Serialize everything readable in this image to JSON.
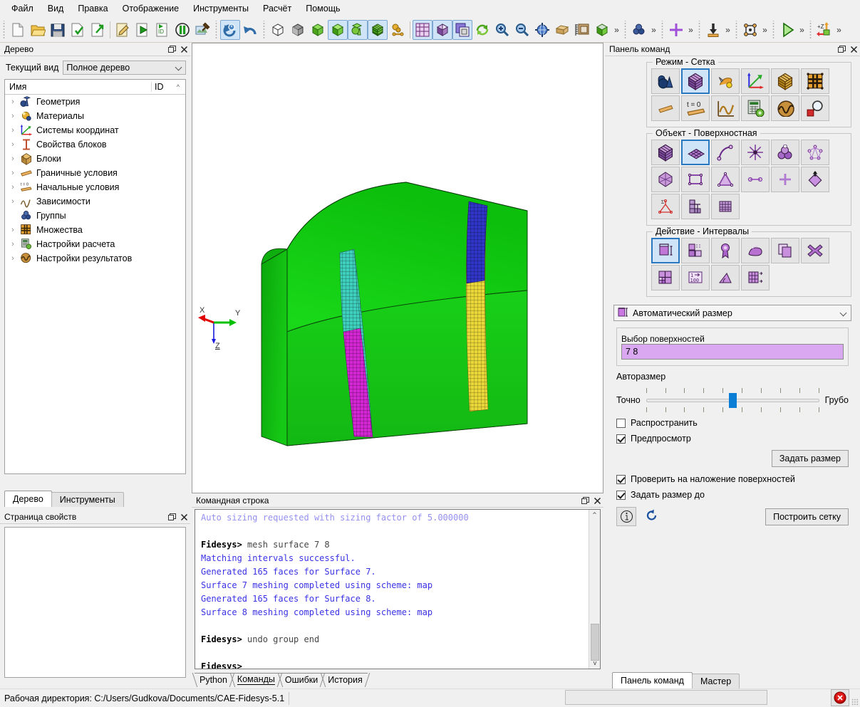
{
  "menu": {
    "items": [
      "Файл",
      "Вид",
      "Правка",
      "Отображение",
      "Инструменты",
      "Расчёт",
      "Помощь"
    ]
  },
  "toolbar": {
    "groups": [
      {
        "name": "file-group",
        "buttons": [
          {
            "icon": "new-document-icon",
            "active": false
          },
          {
            "icon": "open-folder-icon",
            "active": false
          },
          {
            "icon": "save-floppy-icon",
            "active": false
          },
          {
            "icon": "import-journal-icon",
            "active": false
          },
          {
            "icon": "export-journal-icon",
            "active": false
          },
          {
            "sep": true
          },
          {
            "icon": "edit-journal-icon",
            "active": false
          },
          {
            "icon": "play-journal-icon",
            "active": false
          },
          {
            "icon": "id-document-icon",
            "active": false
          },
          {
            "icon": "pause-icon",
            "active": false
          },
          {
            "icon": "build-hammer-icon",
            "active": false
          }
        ]
      },
      {
        "name": "undo-group",
        "buttons": [
          {
            "icon": "reset-undo-icon",
            "active": true
          },
          {
            "icon": "undo-arrow-icon",
            "active": false
          }
        ]
      },
      {
        "name": "display-group",
        "buttons": [
          {
            "icon": "wireframe-cube-icon",
            "active": false
          },
          {
            "icon": "hidden-line-cube-icon",
            "active": false
          },
          {
            "icon": "shaded-cube-icon",
            "active": false
          },
          {
            "icon": "smooth-shaded-cube-icon",
            "active": true
          },
          {
            "icon": "transparent-primitives-icon",
            "active": true
          },
          {
            "icon": "mesh-cube-icon",
            "active": true
          },
          {
            "icon": "composite-geometry-icon",
            "active": false
          },
          {
            "sep": true
          },
          {
            "icon": "grid-plane-icon",
            "active": true
          },
          {
            "icon": "clip-cube-icon",
            "active": true
          },
          {
            "icon": "layers-icon",
            "active": true
          },
          {
            "icon": "refresh-icon",
            "active": false
          },
          {
            "icon": "zoom-in-icon",
            "active": false
          },
          {
            "icon": "zoom-out-icon",
            "active": false
          },
          {
            "icon": "rotate-globe-icon",
            "active": false
          },
          {
            "icon": "fit-view-icon",
            "active": false
          },
          {
            "icon": "measure-ruler-icon",
            "active": false
          },
          {
            "icon": "isometric-view-icon",
            "active": false
          }
        ]
      },
      {
        "name": "group-group",
        "buttons": [
          {
            "icon": "groups-icon",
            "active": false
          }
        ]
      },
      {
        "name": "bc-group",
        "buttons": [
          {
            "icon": "constraint-cross-icon",
            "active": false
          }
        ]
      },
      {
        "name": "load-group",
        "buttons": [
          {
            "icon": "pressure-load-icon",
            "active": false
          }
        ]
      },
      {
        "name": "contact-group",
        "buttons": [
          {
            "icon": "contact-pair-icon",
            "active": false
          }
        ]
      },
      {
        "name": "solve-group",
        "buttons": [
          {
            "icon": "run-solver-icon",
            "active": false
          }
        ]
      },
      {
        "name": "view-axis-group",
        "buttons": [
          {
            "icon": "z-axis-view-icon",
            "active": false
          }
        ]
      }
    ],
    "overflow_label": "»"
  },
  "tree_panel": {
    "title": "Дерево",
    "current_view_label": "Текущий вид",
    "current_view_value": "Полное дерево",
    "columns": [
      "Имя",
      "ID"
    ],
    "items": [
      {
        "label": "Геометрия",
        "icon": "geometry-icon",
        "expandable": true
      },
      {
        "label": "Материалы",
        "icon": "materials-icon",
        "expandable": true
      },
      {
        "label": "Системы координат",
        "icon": "coordinate-systems-icon",
        "expandable": true
      },
      {
        "label": "Свойства блоков",
        "icon": "block-properties-icon",
        "expandable": true
      },
      {
        "label": "Блоки",
        "icon": "blocks-icon",
        "expandable": true
      },
      {
        "label": "Граничные условия",
        "icon": "boundary-conditions-icon",
        "expandable": true
      },
      {
        "label": "Начальные условия",
        "icon": "initial-conditions-icon",
        "expandable": true
      },
      {
        "label": "Зависимости",
        "icon": "dependencies-icon",
        "expandable": true
      },
      {
        "label": "Группы",
        "icon": "groups-icon",
        "expandable": false
      },
      {
        "label": "Множества",
        "icon": "sets-icon",
        "expandable": true
      },
      {
        "label": "Настройки расчета",
        "icon": "solver-settings-icon",
        "expandable": true
      },
      {
        "label": "Настройки результатов",
        "icon": "results-settings-icon",
        "expandable": true
      }
    ]
  },
  "left_bottom_tabs": [
    {
      "label": "Дерево",
      "selected": true
    },
    {
      "label": "Инструменты",
      "selected": false
    }
  ],
  "property_panel": {
    "title": "Страница свойств",
    "content": ""
  },
  "viewport": {
    "triad": {
      "x": "X",
      "y": "Y",
      "z": "Z"
    },
    "model_colors": {
      "body": "#00c000",
      "mesh_band_left": "#cc22cc",
      "mesh_band_right": "#e0d020",
      "mesh_band_top_left": "#3cc8b4",
      "mesh_band_top_right": "#2222cc"
    }
  },
  "console": {
    "title": "Командная строка",
    "lines": [
      {
        "text": "Auto sizing requested with sizing factor of 5.000000",
        "style": "clip"
      },
      {
        "text": "",
        "style": "info"
      },
      {
        "prompt": "Fidesys>",
        "cmd": " mesh surface 7 8",
        "style": "prompt"
      },
      {
        "text": "Matching intervals successful.",
        "style": "info"
      },
      {
        "text": "Generated 165 faces for Surface 7.",
        "style": "info"
      },
      {
        "text": "Surface 7 meshing completed using scheme: map",
        "style": "info"
      },
      {
        "text": "Generated 165 faces for Surface 8.",
        "style": "info"
      },
      {
        "text": "Surface 8 meshing completed using scheme: map",
        "style": "info"
      },
      {
        "text": "",
        "style": "info"
      },
      {
        "prompt": "Fidesys>",
        "cmd": " undo group end",
        "style": "prompt"
      },
      {
        "text": "",
        "style": "info"
      },
      {
        "prompt": "Fidesys>",
        "cmd": "",
        "style": "prompt"
      }
    ],
    "tabs": [
      {
        "label": "Python",
        "selected": false
      },
      {
        "label": "Команды",
        "selected": true
      },
      {
        "label": "Ошибки",
        "selected": false
      },
      {
        "label": "История",
        "selected": false
      }
    ]
  },
  "command_panel": {
    "title": "Панель команд",
    "mode_group": {
      "title": "Режим - Сетка",
      "buttons": [
        {
          "icon": "geometry-mode-icon",
          "selected": false
        },
        {
          "icon": "mesh-mode-icon",
          "selected": true
        },
        {
          "icon": "tools-mode-icon",
          "selected": false
        },
        {
          "icon": "coordinate-system-mode-icon",
          "selected": false
        },
        {
          "icon": "blocks-mode-icon",
          "selected": false
        },
        {
          "icon": "sets-mode-icon",
          "selected": false
        },
        {
          "icon": "boundary-conditions-mode-icon",
          "selected": false
        },
        {
          "icon": "initial-conditions-mode-icon",
          "selected": false
        },
        {
          "icon": "dependencies-mode-icon",
          "selected": false
        },
        {
          "icon": "calculation-settings-mode-icon",
          "selected": false
        },
        {
          "icon": "results-mode-icon",
          "selected": false
        },
        {
          "icon": "inspect-mode-icon",
          "selected": false
        }
      ]
    },
    "object_group": {
      "title": "Объект - Поверхностная",
      "buttons": [
        {
          "icon": "volume-object-icon",
          "selected": false
        },
        {
          "icon": "surface-object-icon",
          "selected": true
        },
        {
          "icon": "curve-object-icon",
          "selected": false
        },
        {
          "icon": "vertex-object-icon",
          "selected": false
        },
        {
          "icon": "node-group-object-icon",
          "selected": false
        },
        {
          "icon": "element-object-icon",
          "selected": false
        },
        {
          "icon": "hex-object-icon",
          "selected": false
        },
        {
          "icon": "quad-object-icon",
          "selected": false
        },
        {
          "icon": "tri-object-icon",
          "selected": false
        },
        {
          "icon": "edge-object-icon",
          "selected": false
        },
        {
          "icon": "node-object-icon",
          "selected": false
        },
        {
          "icon": "wedge-object-icon",
          "selected": false
        },
        {
          "icon": "global-object-icon",
          "selected": false
        },
        {
          "icon": "mesh-entity-icon",
          "selected": false
        },
        {
          "icon": "grid-object-icon",
          "selected": false
        }
      ]
    },
    "action_group": {
      "title": "Действие - Интервалы",
      "buttons": [
        {
          "icon": "intervals-action-icon",
          "selected": true
        },
        {
          "icon": "scheme-action-icon",
          "selected": false
        },
        {
          "icon": "quality-action-icon",
          "selected": false
        },
        {
          "icon": "smooth-action-icon",
          "selected": false
        },
        {
          "icon": "copy-mesh-action-icon",
          "selected": false
        },
        {
          "icon": "delete-mesh-action-icon",
          "selected": false
        },
        {
          "icon": "refine-action-icon",
          "selected": false
        },
        {
          "icon": "renumber-action-icon",
          "selected": false
        },
        {
          "icon": "skew-control-action-icon",
          "selected": false
        },
        {
          "icon": "mesh-scale-action-icon",
          "selected": false
        }
      ]
    },
    "size_mode": {
      "value": "Автоматический размер",
      "icon": "auto-size-icon"
    },
    "surface_selection": {
      "title": "Выбор поверхностей",
      "value": "7 8"
    },
    "autosize": {
      "label": "Авторазмер",
      "min_label": "Точно",
      "max_label": "Грубо",
      "value": 5,
      "min": 0,
      "max": 10,
      "ticks": 10
    },
    "checkboxes": [
      {
        "label": "Распространить",
        "checked": false,
        "name": "propagate-checkbox"
      },
      {
        "label": "Предпросмотр",
        "checked": true,
        "name": "preview-checkbox"
      }
    ],
    "set_size_button": {
      "label": "Задать размер",
      "accel": "З"
    },
    "checkboxes2": [
      {
        "label": "Проверить на наложение поверхностей",
        "checked": true,
        "name": "check-overlap-checkbox"
      },
      {
        "label": "Задать размер до",
        "checked": true,
        "name": "set-size-to-checkbox"
      }
    ],
    "info_button": {
      "icon": "info-icon"
    },
    "reset_button": {
      "icon": "reset-arrow-icon"
    },
    "build_mesh_button": {
      "label": "Построить сетку"
    },
    "tabs": [
      {
        "label": "Панель команд",
        "selected": true
      },
      {
        "label": "Мастер",
        "selected": false
      }
    ]
  },
  "status_bar": {
    "working_dir": "Рабочая директория: C:/Users/Gudkova/Documents/CAE-Fidesys-5.1",
    "input_value": "",
    "stop_icon": "stop-button-icon"
  }
}
